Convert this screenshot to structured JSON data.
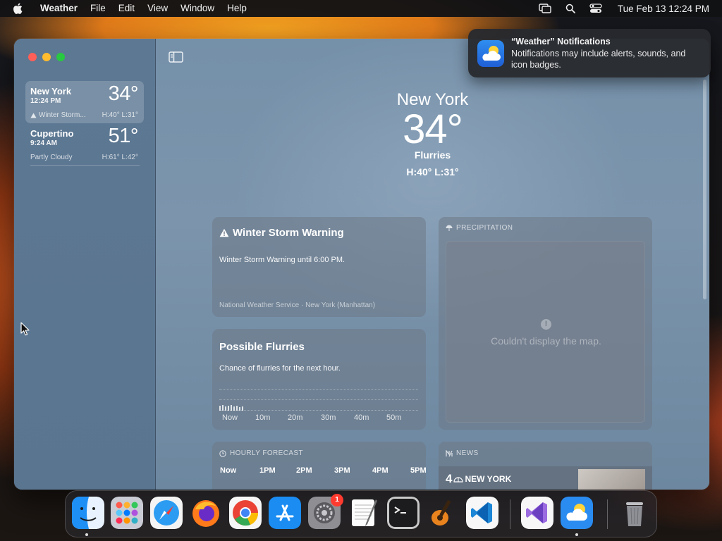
{
  "menubar": {
    "apple_icon": "apple-logo-icon",
    "app_name": "Weather",
    "menus": [
      "File",
      "Edit",
      "View",
      "Window",
      "Help"
    ],
    "status_icons": [
      "screen-mirroring-icon",
      "search-icon",
      "control-center-icon"
    ],
    "clock": "Tue Feb 13  12:24 PM"
  },
  "sidebar": {
    "cities": [
      {
        "name": "New York",
        "time": "12:24 PM",
        "temp": "34°",
        "condition": "Winter Storm...",
        "hl": "H:40°  L:31°",
        "selected": true
      },
      {
        "name": "Cupertino",
        "time": "9:24 AM",
        "temp": "51°",
        "condition": "Partly Cloudy",
        "hl": "H:61°  L:42°",
        "selected": false
      }
    ]
  },
  "hero": {
    "city": "New York",
    "temp": "34°",
    "condition": "Flurries",
    "hl": "H:40°  L:31°"
  },
  "warning_card": {
    "title": "Winter Storm Warning",
    "body": "Winter Storm Warning until 6:00 PM.",
    "source": "National Weather Service · New York (Manhattan)"
  },
  "flurries_card": {
    "title": "Possible Flurries",
    "body": "Chance of flurries for the next hour.",
    "ticks": [
      "Now",
      "10m",
      "20m",
      "30m",
      "40m",
      "50m"
    ]
  },
  "precip_card": {
    "header": "PRECIPITATION",
    "message": "Couldn't display the map.",
    "info_glyph": "!"
  },
  "hourly_card": {
    "header": "HOURLY FORECAST",
    "hours": [
      "Now",
      "1PM",
      "2PM",
      "3PM",
      "4PM",
      "5PM"
    ]
  },
  "news_card": {
    "header": "NEWS",
    "outlet_number": "4",
    "outlet": "NEW YORK"
  },
  "notification": {
    "title": "“Weather” Notifications",
    "message": "Notifications may include alerts, sounds, and icon badges."
  },
  "dock": {
    "apps": [
      "Finder",
      "Launchpad",
      "Safari",
      "Firefox",
      "Chrome",
      "App Store",
      "System Settings",
      "TextEdit",
      "Terminal",
      "GarageBand",
      "Visual Studio Code",
      "Visual Studio",
      "Weather",
      "Trash"
    ],
    "settings_badge": "1"
  },
  "colors": {
    "warning_accent": "#ffffff",
    "dock_badge": "#ff3b30",
    "traffic_red": "#ff5f57",
    "traffic_yellow": "#febc2e",
    "traffic_green": "#28c840"
  }
}
